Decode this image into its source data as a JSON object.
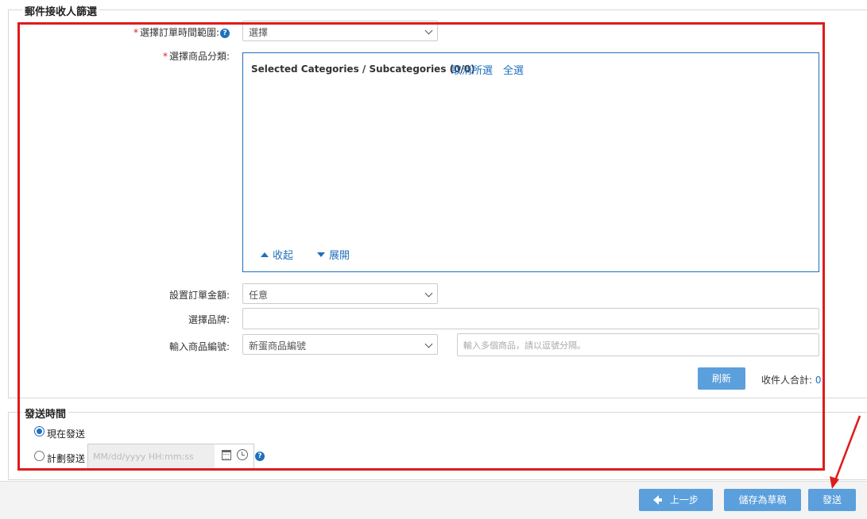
{
  "recipients_section": {
    "legend": "郵件接收人篩選",
    "order_time": {
      "required_mark": "*",
      "label": "選擇訂單時間範圍:",
      "help_icon": "?",
      "select_value": "選擇"
    },
    "category": {
      "required_mark": "*",
      "label": "選擇商品分類:",
      "header": "Selected Categories / Subcategories (0/0)",
      "deselect_all": "取消所選",
      "select_all": "全選",
      "collapse": "收起",
      "expand": "展開"
    },
    "order_amount": {
      "label": "設置訂單金額:",
      "select_value": "任意"
    },
    "brand": {
      "label": "選擇品牌:",
      "value": ""
    },
    "product_code": {
      "label": "輸入商品編號:",
      "select_value": "新蛋商品編號",
      "placeholder": "輸入多個商品，請以逗號分隔。"
    },
    "refresh_label": "刷新",
    "recipient_total_label": "收件人合計:",
    "recipient_total_value": "0"
  },
  "send_time_section": {
    "legend": "發送時間",
    "send_now_label": "現在發送",
    "send_now_selected": true,
    "schedule_label": "計劃發送",
    "datetime_placeholder": "MM/dd/yyyy HH:mm:ss",
    "help_icon": "?"
  },
  "footer": {
    "back_label": "上一步",
    "save_draft_label": "儲存為草稿",
    "send_label": "發送"
  },
  "colors": {
    "accent": "#1f6fbf",
    "button": "#5b9fdc",
    "highlight": "#e01b1b"
  },
  "icons": [
    "help-icon",
    "calendar-icon",
    "clock-icon",
    "arrow-left-icon",
    "caret-up-icon",
    "caret-down-icon",
    "chevron-down-icon"
  ]
}
